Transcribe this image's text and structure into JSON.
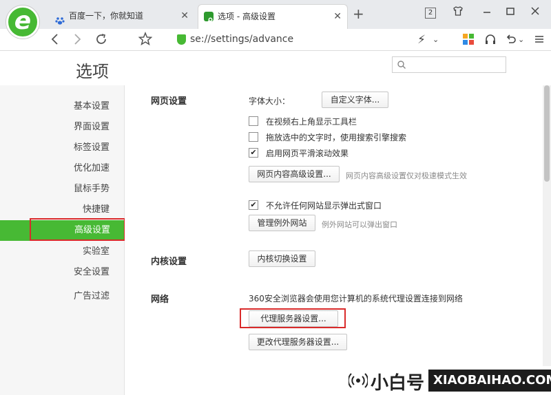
{
  "browser": {
    "logo_letter": "e",
    "tabs": [
      {
        "title": "百度一下，你就知道",
        "icon": "baidu-paw-icon",
        "active": false
      },
      {
        "title": "选项 - 高级设置",
        "icon": "wrench-icon",
        "active": true
      }
    ],
    "new_tab": "+",
    "window_count": "2",
    "url": "se://settings/advance",
    "colors": {
      "accent": "#47b934",
      "highlight": "#d92a2a",
      "sidebar_bg": "#f6f6f6"
    }
  },
  "page": {
    "title": "选项",
    "search_placeholder": ""
  },
  "sidebar": {
    "items": [
      {
        "label": "基本设置"
      },
      {
        "label": "界面设置"
      },
      {
        "label": "标签设置"
      },
      {
        "label": "优化加速"
      },
      {
        "label": "鼠标手势"
      },
      {
        "label": "快捷键"
      },
      {
        "label": "高级设置",
        "active": true
      },
      {
        "label": "实验室"
      },
      {
        "label": "安全设置"
      },
      {
        "label": "广告过滤"
      }
    ]
  },
  "web_settings": {
    "heading": "网页设置",
    "font_size_label": "字体大小：",
    "custom_font_button": "自定义字体...",
    "options": [
      {
        "label": "在视频右上角显示工具栏",
        "checked": false
      },
      {
        "label": "拖放选中的文字时，使用搜索引擎搜索",
        "checked": false
      },
      {
        "label": "启用网页平滑滚动效果",
        "checked": true
      }
    ],
    "advanced_button": "网页内容高级设置...",
    "advanced_note": "网页内容高级设置仅对极速模式生效",
    "popup_option": {
      "label": "不允许任何网站显示弹出式窗口",
      "checked": true
    },
    "exceptions_button": "管理例外网站",
    "exceptions_note": "例外网站可以弹出窗口"
  },
  "kernel_settings": {
    "heading": "内核设置",
    "switch_button": "内核切换设置"
  },
  "network": {
    "heading": "网络",
    "description": "360安全浏览器会使用您计算机的系统代理设置连接到网络",
    "proxy_button": "代理服务器设置...",
    "change_proxy_button": "更改代理服务器设置..."
  },
  "watermark": {
    "cn": "小白号",
    "en": "XIAOBAIHAO.COM"
  }
}
